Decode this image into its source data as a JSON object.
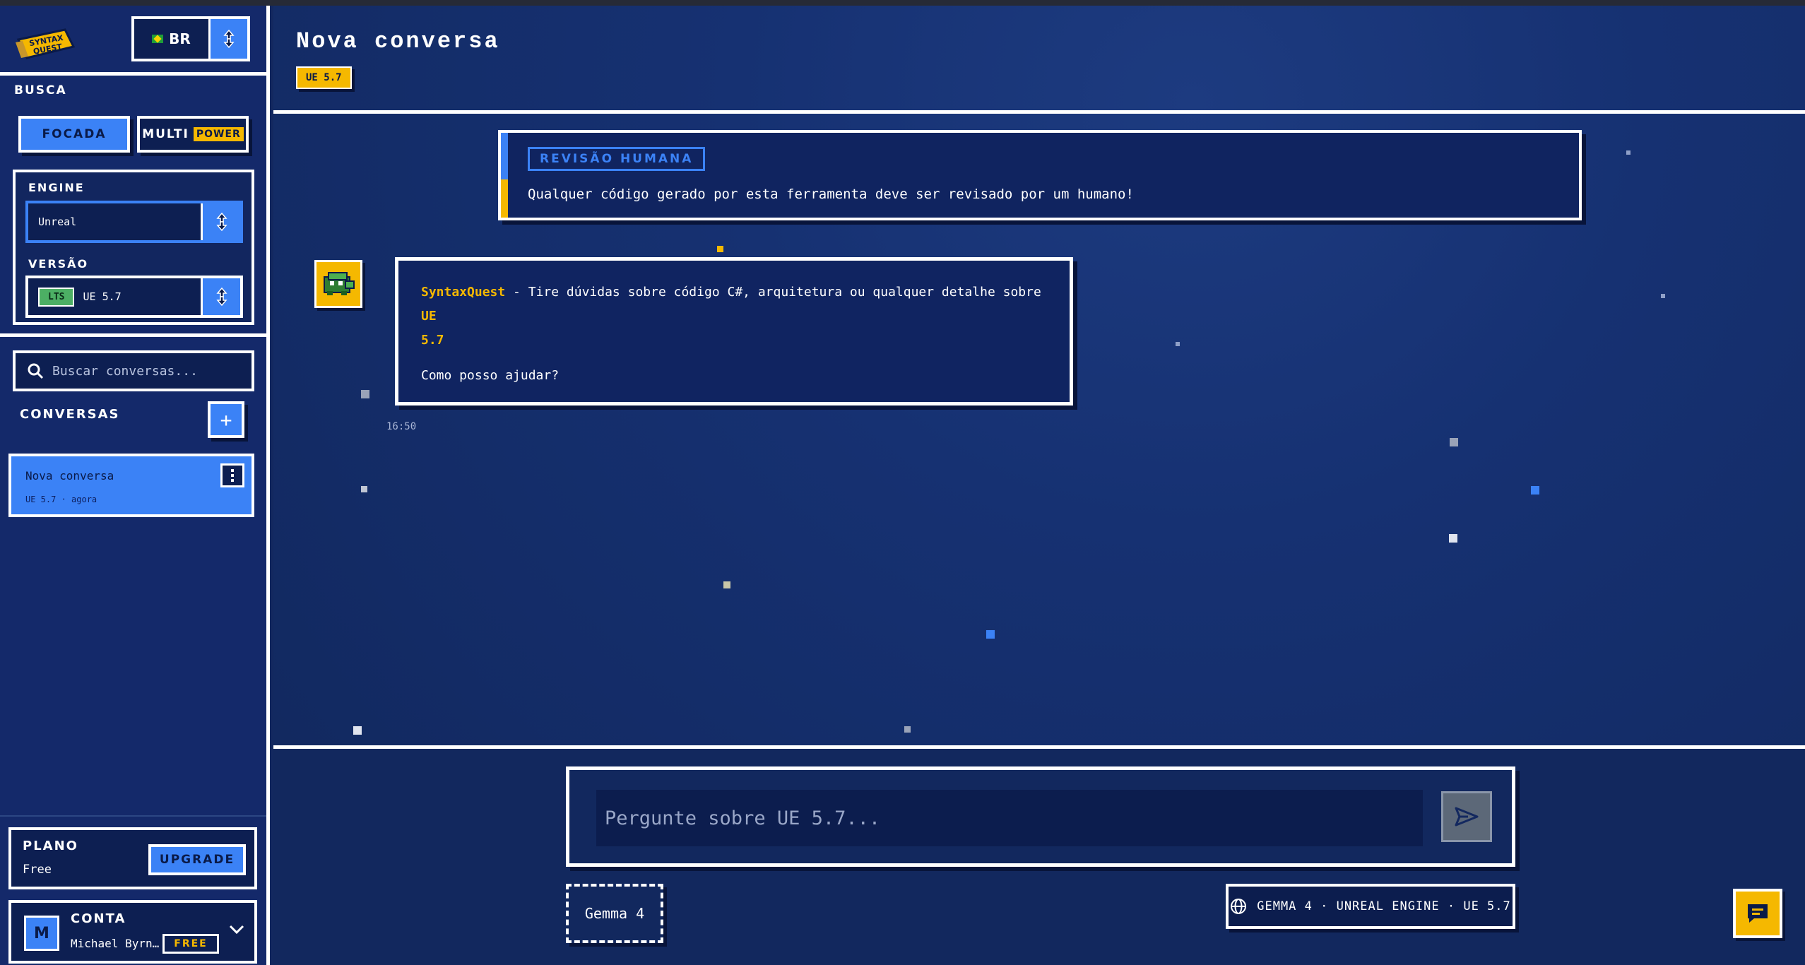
{
  "brand": {
    "logo_text": "SYNTAX QUEST"
  },
  "language": {
    "code": "BR"
  },
  "sidebar": {
    "search_mode": {
      "label": "BUSCA",
      "focused": "FOCADA",
      "multi": "MULTI",
      "power_badge": "POWER"
    },
    "engine": {
      "label": "ENGINE",
      "value": "Unreal"
    },
    "version": {
      "label": "VERSÃO",
      "badge": "LTS",
      "value": "UE 5.7"
    },
    "search": {
      "placeholder": "Buscar conversas..."
    },
    "conversations": {
      "label": "CONVERSAS",
      "add": "+",
      "items": [
        {
          "title": "Nova conversa",
          "meta": "UE 5.7 · agora"
        }
      ]
    },
    "plan": {
      "label": "PLANO",
      "value": "Free",
      "upgrade": "UPGRADE"
    },
    "account": {
      "label": "CONTA",
      "initial": "M",
      "name": "Michael Byrn…",
      "tier": "FREE"
    }
  },
  "header": {
    "title": "Nova conversa",
    "version_tag": "UE 5.7"
  },
  "notice": {
    "tag": "REVISÃO HUMANA",
    "text": "Qualquer código gerado por esta ferramenta deve ser revisado por um humano!"
  },
  "message": {
    "brand": "SyntaxQuest",
    "line1": " - Tire dúvidas sobre código C#, arquitetura ou qualquer detalhe sobre ",
    "version_start": "UE",
    "version_end": "5.7",
    "question": "Como posso ajudar?",
    "time": "16:50"
  },
  "composer": {
    "placeholder": "Pergunte sobre UE 5.7...",
    "model": "Gemma 4",
    "status": "GEMMA 4 · UNREAL ENGINE · UE 5.7"
  },
  "colors": {
    "accent": "#3b82f6",
    "gold": "#f5b800",
    "bg": "#13285f"
  }
}
